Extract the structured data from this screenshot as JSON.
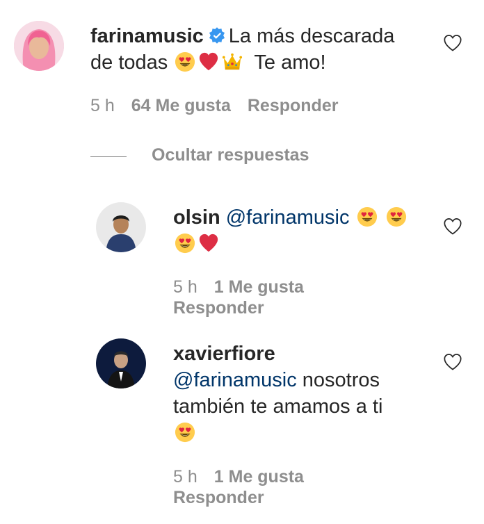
{
  "comment": {
    "username": "farinamusic",
    "text_part1": "La más descarada",
    "text_part2": "de todas",
    "text_end": "Te amo!",
    "time": "5 h",
    "likes": "64 Me gusta",
    "reply_label": "Responder"
  },
  "hide_replies_label": "Ocultar respuestas",
  "replies": [
    {
      "username": "olsin",
      "mention": "@farinamusic",
      "time": "5 h",
      "likes": "1 Me gusta",
      "reply_label": "Responder"
    },
    {
      "username": "xavierfiore",
      "mention": "@farinamusic",
      "text_line1": "nosotros",
      "text_line2": "también te amamos a ti",
      "time": "5 h",
      "likes": "1 Me gusta",
      "reply_label": "Responder"
    }
  ],
  "colors": {
    "text": "#262626",
    "muted": "#8e8e8e",
    "mention": "#003569",
    "verified": "#3897f0"
  },
  "icons": [
    "verified-badge-icon",
    "heart-eyes-emoji-icon",
    "red-heart-emoji-icon",
    "crown-emoji-icon",
    "like-heart-icon"
  ]
}
